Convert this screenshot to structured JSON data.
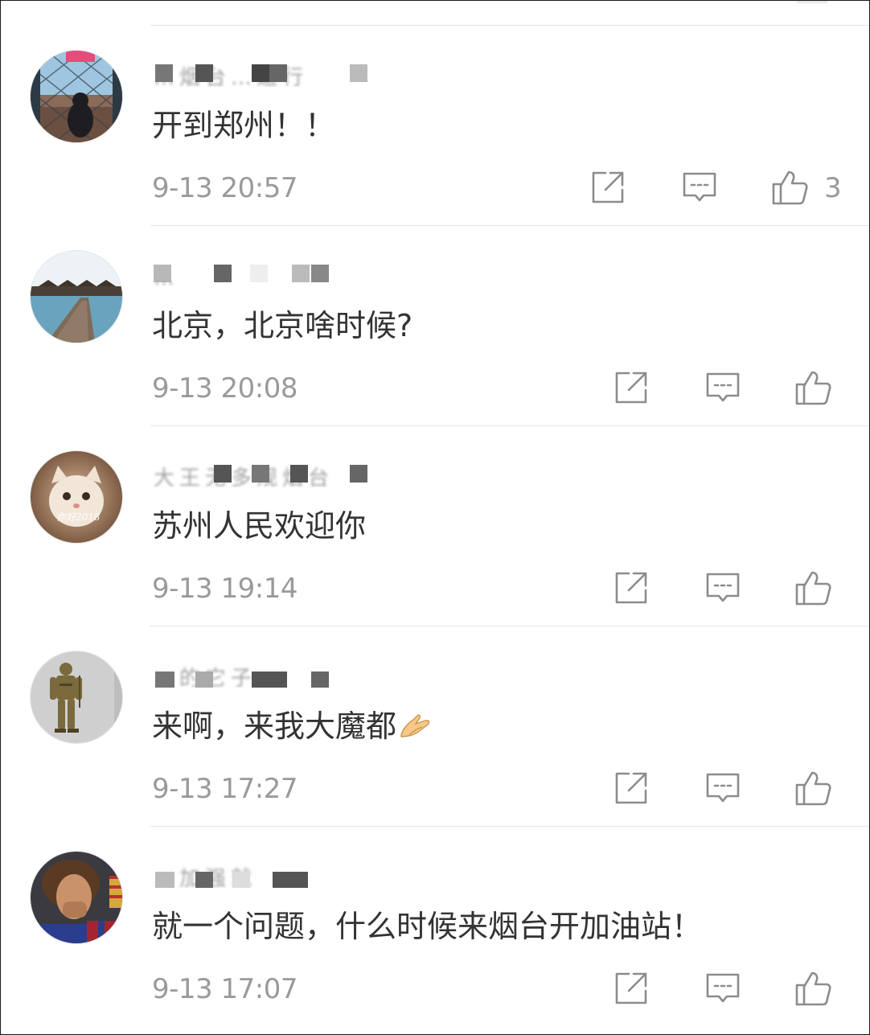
{
  "colors": {
    "text": "#333333",
    "meta": "#9a9a9a",
    "icon": "#8c8c8c",
    "divider": "#e5e5e5"
  },
  "comments": [
    {
      "username": "…烟台…道行",
      "text": "开到郑州！！",
      "time": "9-13 20:57",
      "like_count": "3",
      "avatar": "avatar-window-view"
    },
    {
      "username": "…",
      "text": "北京，北京啥时候?",
      "time": "9-13 20:08",
      "like_count": "",
      "avatar": "avatar-resort-pier"
    },
    {
      "username": "大王无多规烟台",
      "text": "苏州人民欢迎你",
      "time": "9-13 19:14",
      "like_count": "",
      "avatar": "avatar-kitten"
    },
    {
      "username": "…的它子",
      "text": "来啊，来我大魔都",
      "time": "9-13 17:27",
      "like_count": "",
      "avatar": "avatar-armored-warrior"
    },
    {
      "username": "…加强就",
      "text": "就一个问题，什么时候来烟台开加油站！",
      "time": "9-13 17:07",
      "like_count": "",
      "avatar": "avatar-football-player"
    }
  ],
  "icons": {
    "repost": "repost-icon",
    "comment": "comment-icon",
    "like": "thumbs-up-icon",
    "emoji": "hands-together-emoji"
  }
}
